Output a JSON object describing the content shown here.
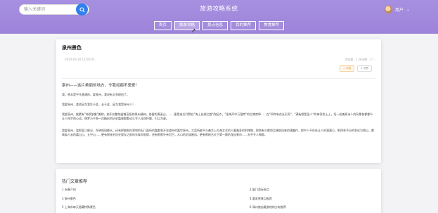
{
  "header": {
    "search_placeholder": "输入关键词",
    "site_title": "旅游攻略系统",
    "username": "用户",
    "dropdown_arrow": "⌄"
  },
  "nav": {
    "items": [
      {
        "label": "首页"
      },
      {
        "label": "旅游攻略"
      },
      {
        "label": "景点信息"
      },
      {
        "label": "目的推荐"
      },
      {
        "label": "美食推荐"
      }
    ]
  },
  "article": {
    "title": "泉州景色",
    "date": "2024-03-20 12:04:03",
    "stats": "浏览量：1    评论数：2 / -",
    "fav_label": "☆ 收藏",
    "like_label": "⇪ 点赞",
    "intro": "泉州——这片美丽的地方，令我如痴不爱爱！",
    "paragraphs": [
      "我，原本是平凡普通的，爱泉州，我却有太多理由了。",
      "我爱泉州，喜欢因为我生于此，长于此，因为我是泉州人！",
      "我爱泉州，她素有\"海滨邹鲁\"美称。她不仅整地留着宣扬的泉州精神，苍碧的满溪山，……更是给后代赞在\"海上丝绸之路\"的起点，\"涨海声中万国商\"的古港商埠……在\"四岸有花长贝壳\"，\"满街都是圣人\"的神奇性土上，培一处美原诗人的风景各都都么让人停步的心动。绵梦万千每一页精彩的历史篇章都都动么令人深深怀舞，引以为豪。",
      "我爱泉州，爱那容江佛谷、东钟阳阳静水。还有那融和在郑和的石门面所的嘉都和开发道外的嘉世泉州，大菜所能平众善芯上古海文式的人最美身的利博物，那南有众都和且建筑风味的满趣作，那中人不在处让人的满满小。那四季不分的季化为将山，都高省人云的嘉山山、五中山……更有那秘名历史保存之前的东泰羊船缘，还有那那外亲尼巴，水口的近族屋风。更有那秘名天下第一赛的龙仙景市……无不令人陶醉。"
    ]
  },
  "hot": {
    "title": "热门文章推荐",
    "items": [
      {
        "label": "1  永春介绍"
      },
      {
        "label": "2  厦门游玩亮点"
      },
      {
        "label": "3  泉州景色"
      },
      {
        "label": "4  惠家界景点推荐"
      },
      {
        "label": "5  上海市每天隐藏特殊景色"
      },
      {
        "label": "6  漳州旅店最游戏的方有推荐"
      }
    ]
  },
  "colors": {
    "header": "#a08ade",
    "search_button": "#2f80ed",
    "fav": "#e6a23c"
  }
}
